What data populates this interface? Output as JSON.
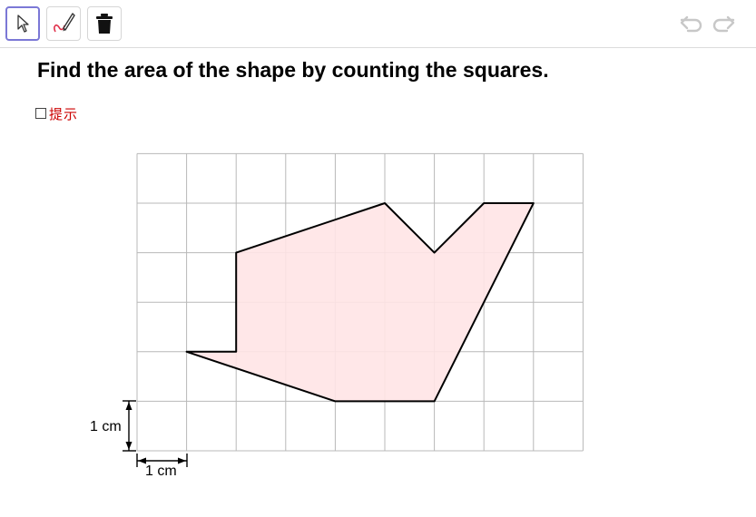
{
  "toolbar": {
    "tools": [
      {
        "name": "move-tool",
        "icon": "arrow-pointer-icon",
        "active": true
      },
      {
        "name": "pen-tool",
        "icon": "pen-icon",
        "active": false
      },
      {
        "name": "delete-tool",
        "icon": "trash-icon",
        "active": false
      }
    ],
    "undo_icon": "undo-icon",
    "redo_icon": "redo-icon"
  },
  "question": "Find the area of the shape by counting the squares.",
  "hint": {
    "label": "提示",
    "checked": false
  },
  "grid": {
    "columns": 9,
    "rows": 6,
    "shape_vertices": [
      [
        1,
        2
      ],
      [
        2,
        2
      ],
      [
        2,
        4
      ],
      [
        5,
        5
      ],
      [
        6,
        4
      ],
      [
        7,
        5
      ],
      [
        8,
        5
      ],
      [
        6,
        1
      ],
      [
        4,
        1
      ]
    ],
    "shape_fill": "#ffe4e6",
    "grid_color": "#b8b8b8",
    "vertical_scale_label": "1 cm",
    "horizontal_scale_label": "1 cm"
  }
}
